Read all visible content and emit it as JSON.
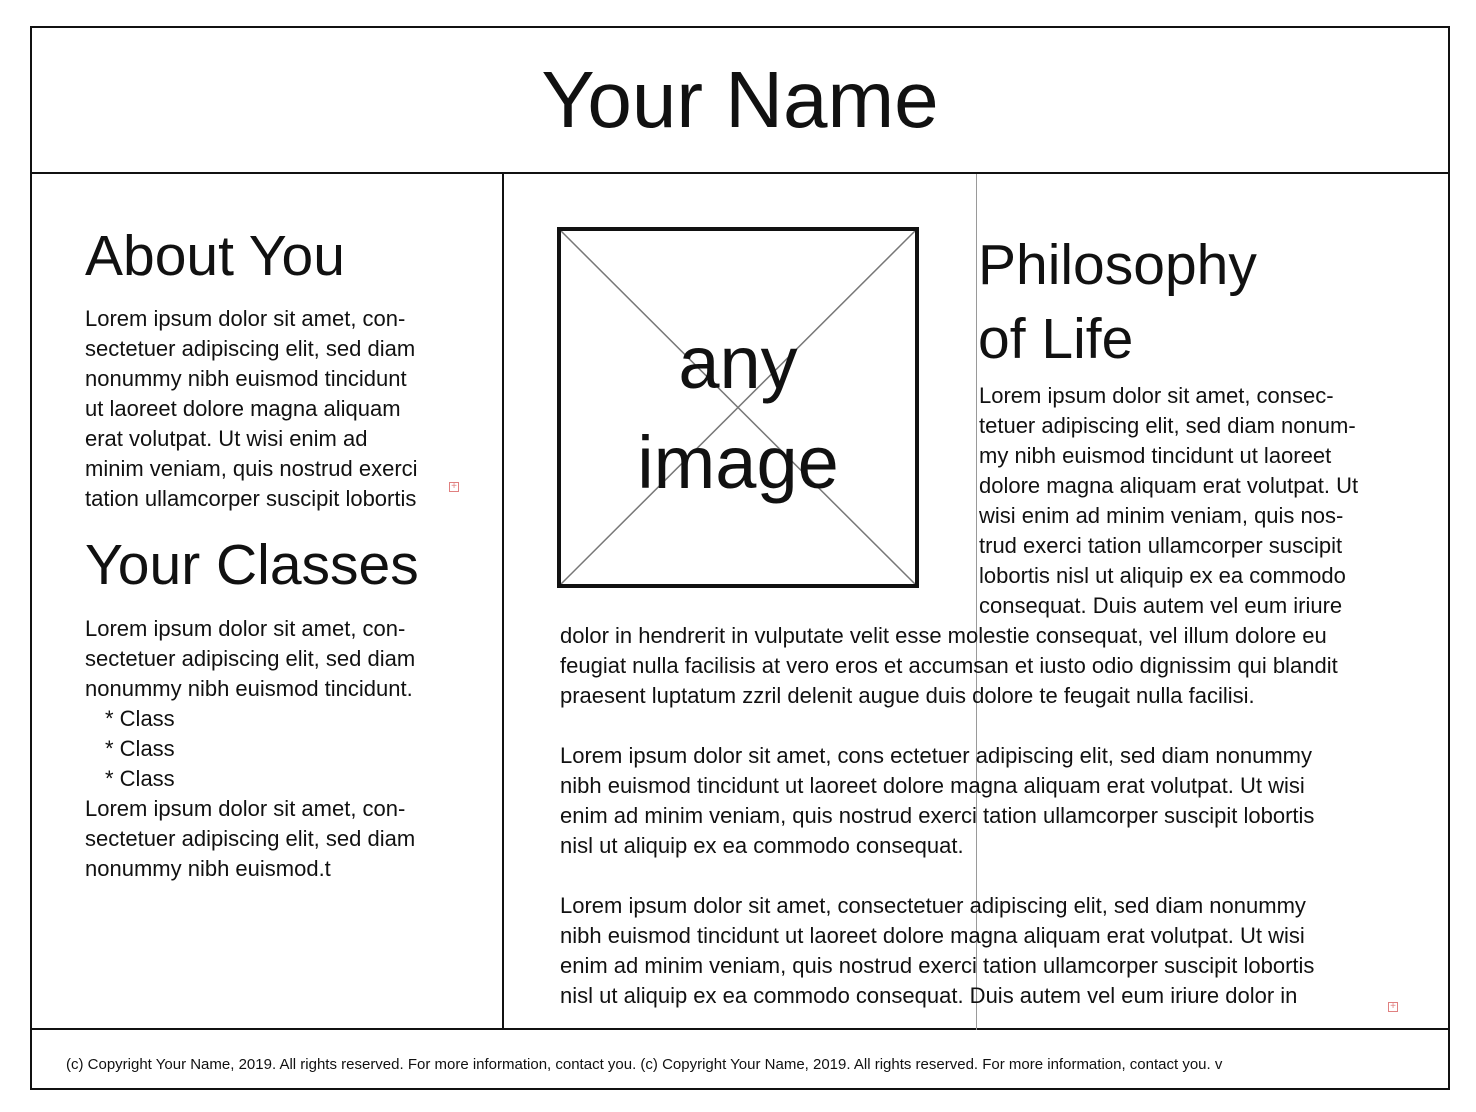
{
  "header": {
    "title": "Your Name"
  },
  "about": {
    "heading": "About You",
    "lines": [
      "Lorem ipsum dolor sit amet, con-",
      "sectetuer adipiscing elit, sed diam",
      "nonummy nibh euismod tincidunt",
      "ut laoreet dolore magna aliquam",
      "erat volutpat. Ut wisi enim ad",
      "minim veniam, quis nostrud exerci",
      "tation ullamcorper suscipit lobortis"
    ]
  },
  "classes": {
    "heading": "Your Classes",
    "intro_lines": [
      "Lorem ipsum dolor sit amet, con-",
      "sectetuer adipiscing elit, sed diam",
      "nonummy nibh euismod tincidunt."
    ],
    "items": [
      "* Class",
      "* Class",
      "* Class"
    ],
    "outro_lines": [
      "Lorem ipsum dolor sit amet, con-",
      "sectetuer adipiscing elit, sed diam",
      "nonummy nibh euismod.t"
    ]
  },
  "image": {
    "placeholder_line1": "any",
    "placeholder_line2": "image"
  },
  "philosophy": {
    "heading_line1": "Philosophy",
    "heading_line2": "of Life",
    "narrow_lines": [
      "Lorem ipsum dolor sit amet, consec-",
      "tetuer adipiscing elit, sed diam nonum-",
      "my nibh euismod tincidunt ut laoreet",
      "dolore magna aliquam erat volutpat. Ut",
      "wisi enim ad minim veniam, quis nos-",
      "trud exerci tation ullamcorper suscipit",
      "lobortis nisl ut aliquip ex ea commodo",
      "consequat. Duis autem vel eum iriure"
    ],
    "wide_lines": [
      "dolor in hendrerit in vulputate velit esse molestie consequat, vel illum dolore eu",
      "feugiat nulla facilisis at vero eros et accumsan et iusto odio dignissim qui blandit",
      "praesent luptatum zzril delenit augue duis dolore te feugait nulla facilisi."
    ],
    "para2_lines": [
      "Lorem ipsum dolor sit amet, cons ectetuer adipiscing elit, sed diam nonummy",
      "nibh euismod tincidunt ut laoreet dolore magna aliquam erat volutpat. Ut wisi",
      "enim ad minim veniam, quis nostrud exerci tation ullamcorper suscipit lobortis",
      "nisl ut aliquip ex ea commodo consequat."
    ],
    "para3_lines": [
      "Lorem ipsum dolor sit amet, consectetuer adipiscing elit, sed diam nonummy",
      "nibh euismod tincidunt ut laoreet dolore magna aliquam erat volutpat. Ut wisi",
      "enim ad minim veniam, quis nostrud exerci tation ullamcorper suscipit lobortis",
      "nisl ut aliquip ex ea commodo consequat. Duis autem vel eum iriure dolor in"
    ]
  },
  "footer": {
    "text": "(c) Copyright Your Name, 2019. All rights reserved. For more information, contact you. (c) Copyright Your Name, 2019. All rights reserved. For more information, contact you. v"
  },
  "colors": {
    "ink": "#111111",
    "guide": "#9a9a9a",
    "overflow_marker": "#e08080"
  },
  "icons": {
    "overflow": "overflow-plus-icon"
  }
}
